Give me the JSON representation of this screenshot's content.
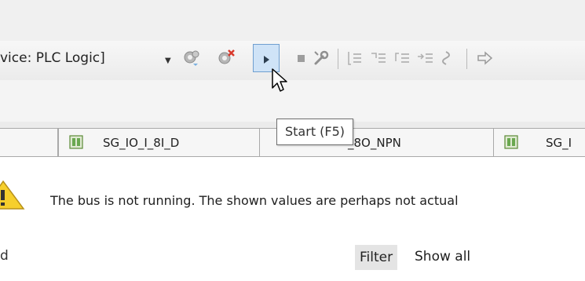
{
  "toolbar": {
    "device_label": "vice: PLC Logic]",
    "dropdown_arrow": "▼",
    "icons": [
      "login-gear-icon",
      "logout-gear-icon",
      "start-icon",
      "stop-icon",
      "reset-wrench-icon",
      "step-over-icon",
      "step-into-icon",
      "step-out-icon",
      "run-to-cursor-icon",
      "set-next-statement-icon",
      "show-current-statement-icon"
    ]
  },
  "tooltip": {
    "text": "Start (F5)"
  },
  "tabs": [
    {
      "label": ""
    },
    {
      "label": "SG_IO_I_8I_D"
    },
    {
      "label": "_8O_NPN"
    },
    {
      "label": "SG_I"
    }
  ],
  "message": {
    "text": "The bus is not running. The shown values are perhaps not actual"
  },
  "bottom": {
    "partial_label": "d",
    "filter_label": "Filter",
    "filter_value": "Show all"
  },
  "colors": {
    "start_button_bg": "#cfe3f7",
    "start_button_border": "#6f9fd0",
    "warning_yellow": "#f6cf2c",
    "gear_red": "#d8382b"
  }
}
